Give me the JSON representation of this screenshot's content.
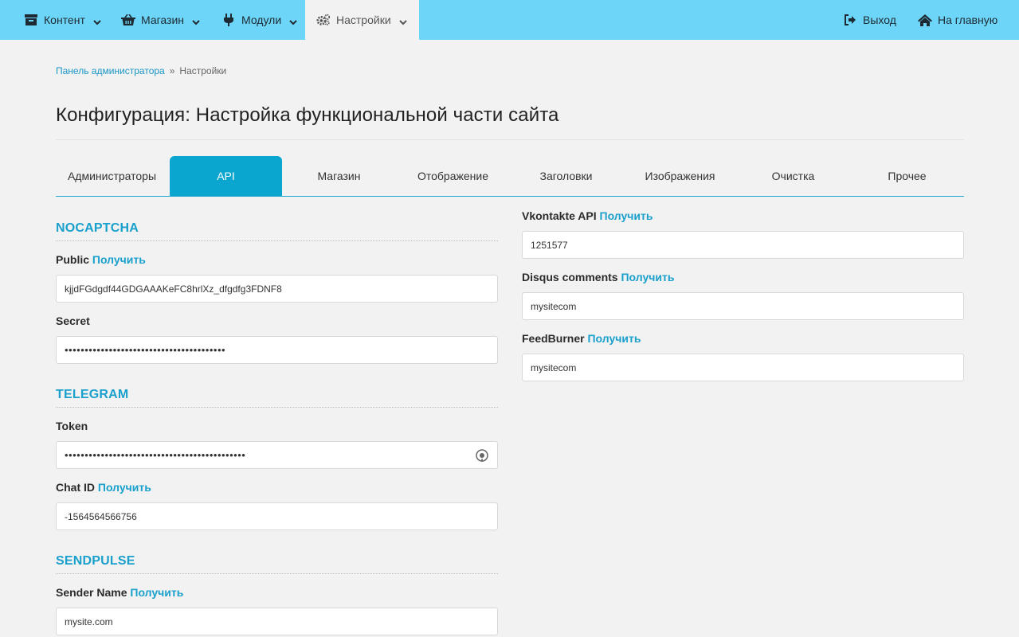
{
  "nav": {
    "content": "Контент",
    "shop": "Магазин",
    "modules": "Модули",
    "settings": "Настройки",
    "logout": "Выход",
    "home": "На главную"
  },
  "breadcrumb": {
    "root": "Панель администратора",
    "sep": "»",
    "current": "Настройки"
  },
  "page_title": "Конфигурация: Настройка функциональной части сайта",
  "tabs": [
    "Администраторы",
    "API",
    "Магазин",
    "Отображение",
    "Заголовки",
    "Изображения",
    "Очистка",
    "Прочее"
  ],
  "get_label": "Получить",
  "left": {
    "nocaptcha": {
      "heading": "NOCAPTCHA",
      "public_label": "Public",
      "public_value": "kjjdFGdgdf44GDGAAAKeFC8hrlXz_dfgdfg3FDNF8",
      "secret_label": "Secret",
      "secret_value": "••••••••••••••••••••••••••••••••••••••••"
    },
    "telegram": {
      "heading": "TELEGRAM",
      "token_label": "Token",
      "token_value": "•••••••••••••••••••••••••••••••••••••••••••••",
      "chat_label": "Chat ID",
      "chat_value": "-1564564566756"
    },
    "sendpulse": {
      "heading": "SENDPULSE",
      "sender_label": "Sender Name",
      "sender_value": "mysite.com"
    }
  },
  "right": {
    "vk_label": "Vkontakte API",
    "vk_value": "1251577",
    "disqus_label": "Disqus comments",
    "disqus_value": "mysitecom",
    "feed_label": "FeedBurner",
    "feed_value": "mysitecom"
  },
  "colors": {
    "nav_bg": "#6dd5f7",
    "accent": "#0aa6cf",
    "heading": "#1aa0cc"
  }
}
